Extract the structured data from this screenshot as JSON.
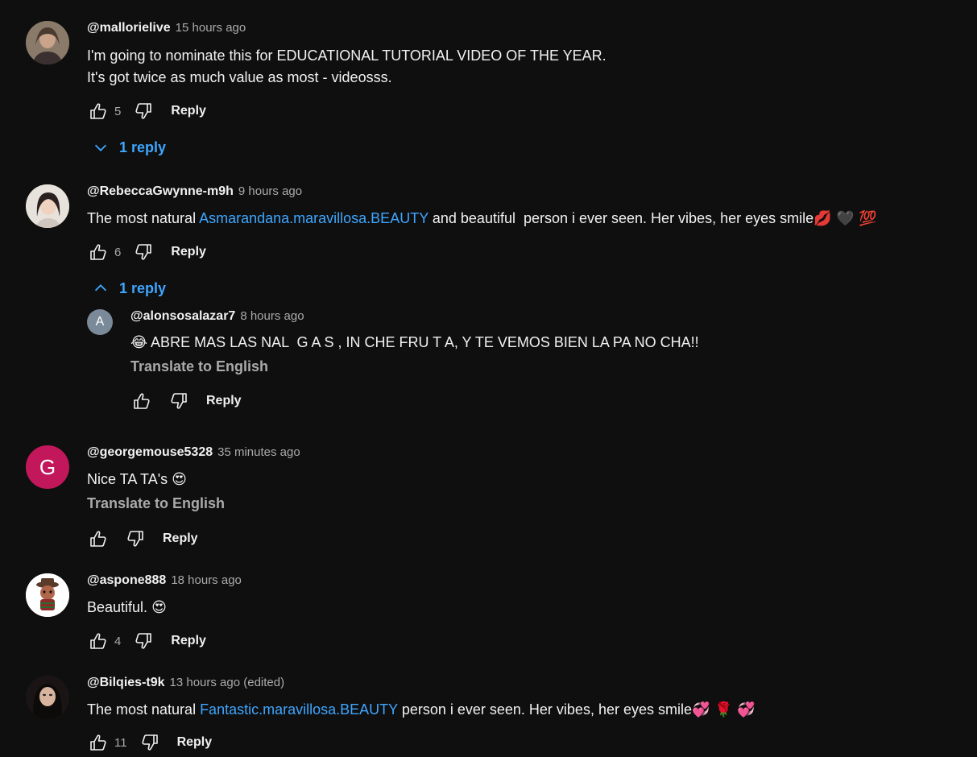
{
  "comments": [
    {
      "author": "@mallorielive",
      "time": "15 hours ago",
      "text_line1": "I'm going to nominate this for EDUCATIONAL TUTORIAL VIDEO OF THE YEAR.",
      "text_line2": "It's got twice as much value as most - videosss.",
      "likes": "5",
      "reply_label": "Reply",
      "replies_label": "1 reply",
      "avatar_color": "#6b5a4a"
    },
    {
      "author": "@RebeccaGwynne-m9h",
      "time": "9 hours ago",
      "text_before": "The most natural ",
      "link": "Asmarandana.maravillosa.BEAUTY",
      "text_after": " and beautiful  person i ever seen. Her vibes, her eyes smile",
      "emojis": "💋 🖤 💯",
      "likes": "6",
      "reply_label": "Reply",
      "replies_label": "1 reply",
      "avatar_color": "#d9cfc8",
      "reply": {
        "author": "@alonsosalazar7",
        "time": "8 hours ago",
        "avatar_letter": "A",
        "avatar_color": "#7a8a99",
        "emoji": "😂",
        "text": " ABRE MAS LAS NAL  G A S , IN CHE FRU T A, Y TE VEMOS BIEN LA PA NO CHA!!",
        "translate": "Translate to English",
        "reply_label": "Reply"
      }
    },
    {
      "author": "@georgemouse5328",
      "time": "35 minutes ago",
      "avatar_letter": "G",
      "avatar_color": "#c2185b",
      "text": "Nice TA TA's ",
      "emoji": "😍",
      "translate": "Translate to English",
      "reply_label": "Reply"
    },
    {
      "author": "@aspone888",
      "time": "18 hours ago",
      "text": "Beautiful. ",
      "emoji": "😍",
      "likes": "4",
      "reply_label": "Reply",
      "avatar_color": "#ffffff"
    },
    {
      "author": "@Bilqies-t9k",
      "time": "13 hours ago (edited)",
      "text_before": "The most natural ",
      "link": "Fantastic.maravillosa.BEAUTY",
      "text_after": " person i ever seen. Her vibes, her eyes smile",
      "emojis": "💞 🌹 💞",
      "likes": "11",
      "reply_label": "Reply",
      "avatar_color": "#2a2020"
    }
  ],
  "colors": {
    "background": "#0f0f0f",
    "link": "#3ea6ff",
    "text": "#f1f1f1",
    "muted": "#aaaaaa"
  }
}
